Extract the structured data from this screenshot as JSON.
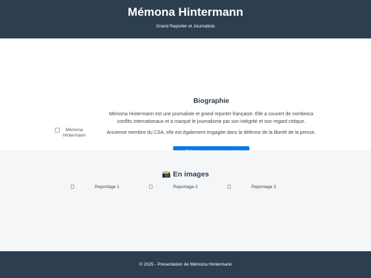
{
  "header": {
    "name": "Mémona Hintermann",
    "subtitle": "Grand Reporter et Journaliste"
  },
  "bio": {
    "portrait_alt": "Mémona Hintermann",
    "title": "Biographie",
    "paragraph1": "Mémona Hintermann est une journaliste et grand reporter française. Elle a couvert de nombreux conflits internationaux et a marqué le journalisme par son intégrité et son regard critique.",
    "paragraph2": "Ancienne membre du CSA, elle est également engagée dans la défense de la liberté de la presse.",
    "download_label": "📥 Télécharger la présentation"
  },
  "gallery": {
    "title": "📸 En images",
    "items": [
      "Reportage 1",
      "Reportage 2",
      "Reportage 3"
    ]
  },
  "footer": {
    "text": "© 2025 - Présentation de Mémona Hintermann"
  }
}
